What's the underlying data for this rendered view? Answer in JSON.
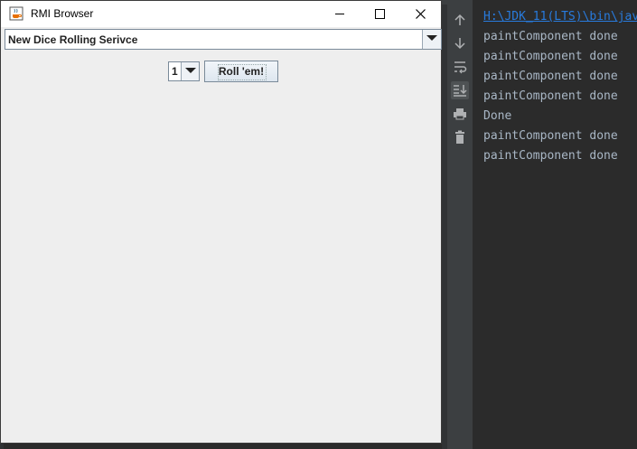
{
  "window": {
    "title": "RMI Browser",
    "service_selected": "New Dice Rolling Serivce",
    "dice_count": "1",
    "roll_label": "Roll 'em!"
  },
  "console": {
    "lines": [
      "H:\\JDK_11(LTS)\\bin\\jav",
      "paintComponent done",
      "paintComponent done",
      "paintComponent done",
      "paintComponent done",
      "Done",
      "paintComponent done",
      "paintComponent done"
    ]
  },
  "toolbar": {
    "icons": [
      "up-arrow-icon",
      "down-arrow-icon",
      "soft-wrap-icon",
      "scroll-to-end-icon",
      "print-icon",
      "trash-icon"
    ]
  },
  "colors": {
    "console_text": "#a9b7c6",
    "link": "#287bde",
    "window_bg": "#eeeeee"
  }
}
